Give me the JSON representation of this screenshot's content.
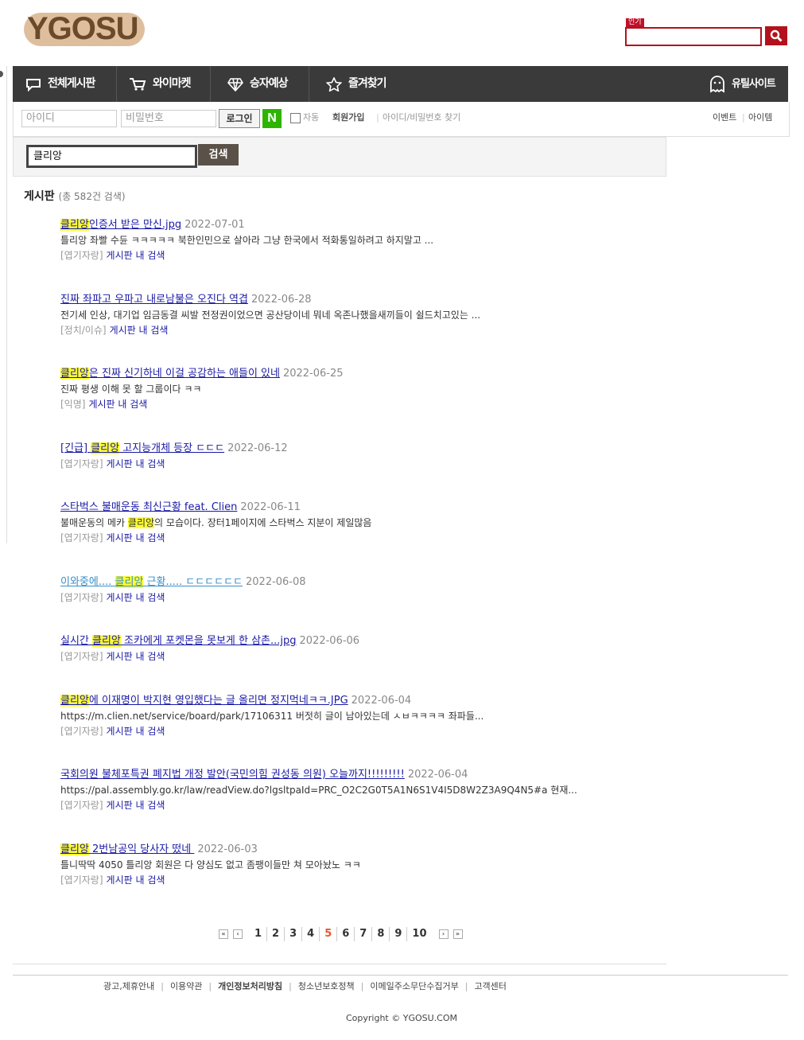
{
  "header": {
    "logo_text": "YGOSU",
    "popular_label": "인기",
    "search_placeholder": ""
  },
  "nav": {
    "items": [
      {
        "label": "전체게시판",
        "icon": "speech-bubble-icon"
      },
      {
        "label": "와이마켓",
        "icon": "cart-icon"
      },
      {
        "label": "승자예상",
        "icon": "diamond-icon"
      },
      {
        "label": "즐겨찾기",
        "icon": "star-icon"
      }
    ],
    "right_label": "유틸사이트"
  },
  "login": {
    "id_placeholder": "아이디",
    "pw_placeholder": "비밀번호",
    "login_label": "로그인",
    "naver_label": "N",
    "auto_label": "자동",
    "join_label": "회원가입",
    "find_label": "아이디/비밀번호 찾기",
    "event_label": "이벤트",
    "item_label": "아이템"
  },
  "search": {
    "query": "클리앙",
    "button_label": "검색"
  },
  "results_header": {
    "title": "게시판",
    "count": "(총 582건 검색)"
  },
  "results": [
    {
      "hl_pre": "",
      "hl": "클리앙",
      "title_rest": "인증서 받은 만신.jpg",
      "date": "2022-07-01",
      "body_pre": "틀리앙 좌빨 수듄 ㅋㅋㅋㅋㅋ 북한인민으로 살아라 그냥 한국에서 적화통일하려고 하지말고 ...",
      "body_hl": "",
      "body_post": "",
      "board": "[엽기자랑]",
      "link": "게시판 내 검색"
    },
    {
      "hl_pre": "진짜 좌파고 우파고 내로남불은 오진다 역겹",
      "hl": "",
      "title_rest": "",
      "date": "2022-06-28",
      "body_pre": "전기세 인상, 대기업 임금동결 씨발 전정권이었으면 공산당이네 뭐네 옥존나했을새끼들이 쉴드치고있는 ...",
      "body_hl": "",
      "body_post": "",
      "board": "[정치/이슈]",
      "link": "게시판 내 검색"
    },
    {
      "hl_pre": "",
      "hl": "클리앙",
      "title_rest": "은 진짜 신기하네 이걸 공감하는 애들이 있네",
      "date": "2022-06-25",
      "body_pre": "진짜 평생 이해 못 할 그룹이다 ㅋㅋ",
      "body_hl": "",
      "body_post": "",
      "board": "[익명]",
      "link": "게시판 내 검색"
    },
    {
      "hl_pre": "[긴급] ",
      "hl": "클리앙",
      "title_rest": " 고지능개체 등장 ㄷㄷㄷ",
      "date": "2022-06-12",
      "body_pre": "",
      "body_hl": "",
      "body_post": "",
      "board": "[엽기자랑]",
      "link": "게시판 내 검색"
    },
    {
      "hl_pre": "스타벅스 불매운동 최신근황 feat. Clien",
      "hl": "",
      "title_rest": "",
      "date": "2022-06-11",
      "body_pre": "불매운동의 메카 ",
      "body_hl": "클리앙",
      "body_post": "의 모습이다. 장터1페이지에 스타벅스 지분이 제일많음",
      "board": "[엽기자랑]",
      "link": "게시판 내 검색"
    },
    {
      "hl_pre": "이와중에.... ",
      "hl": "클리앙",
      "title_rest": " 근황..... ㄷㄷㄷㄷㄷㄷ",
      "date": "2022-06-08",
      "body_pre": "",
      "body_hl": "",
      "body_post": "",
      "board": "[엽기자랑]",
      "link": "게시판 내 검색",
      "visited": true
    },
    {
      "hl_pre": "실시간 ",
      "hl": "클리앙",
      "title_rest": " 조카에게 포켓몬을 못보게 한 삼촌...jpg",
      "date": "2022-06-06",
      "body_pre": "",
      "body_hl": "",
      "body_post": "",
      "board": "[엽기자랑]",
      "link": "게시판 내 검색"
    },
    {
      "hl_pre": "",
      "hl": "클리앙",
      "title_rest": "에 이재명이 박지현 영입했다는 글 올리면 정지먹네ㅋㅋ.JPG",
      "date": "2022-06-04",
      "body_pre": "https://m.clien.net/service/board/park/17106311 버젓히 글이 남아있는데 ㅅㅂㅋㅋㅋㅋ 좌파들...",
      "body_hl": "",
      "body_post": "",
      "board": "[엽기자랑]",
      "link": "게시판 내 검색"
    },
    {
      "hl_pre": "국회의원 불체포특권 폐지법 개정 발안(국민의힘 권성동 의원) 오늘까지!!!!!!!!!",
      "hl": "",
      "title_rest": "",
      "date": "2022-06-04",
      "body_pre": "https://pal.assembly.go.kr/law/readView.do?lgsltpaId=PRC_O2C2G0T5A1N6S1V4I5D8W2Z3A9Q4N5#a 현재...",
      "body_hl": "",
      "body_post": "",
      "board": "[엽기자랑]",
      "link": "게시판 내 검색"
    },
    {
      "hl_pre": "",
      "hl": "클리앙",
      "title_rest": " 2번남공익 당사자 떴네 ",
      "date": "2022-06-03",
      "body_pre": "틀니딱딱 4050 틀리앙 회원은 다 양심도 없고 좀팽이들만 쳐 모아놨노 ㅋㅋ",
      "body_hl": "",
      "body_post": "",
      "board": "[엽기자랑]",
      "link": "게시판 내 검색"
    }
  ],
  "pagination": {
    "pages": [
      "1",
      "2",
      "3",
      "4",
      "5",
      "6",
      "7",
      "8",
      "9",
      "10"
    ],
    "current": "5",
    "first": "⏮",
    "prev": "◀",
    "next": "▶",
    "last": "⏭"
  },
  "footer": {
    "links": [
      "광고,제휴안내",
      "이용약관",
      "개인정보처리방침",
      "청소년보호정책",
      "이메일주소무단수집거부",
      "고객센터"
    ],
    "copyright": "Copyright © YGOSU.COM"
  }
}
